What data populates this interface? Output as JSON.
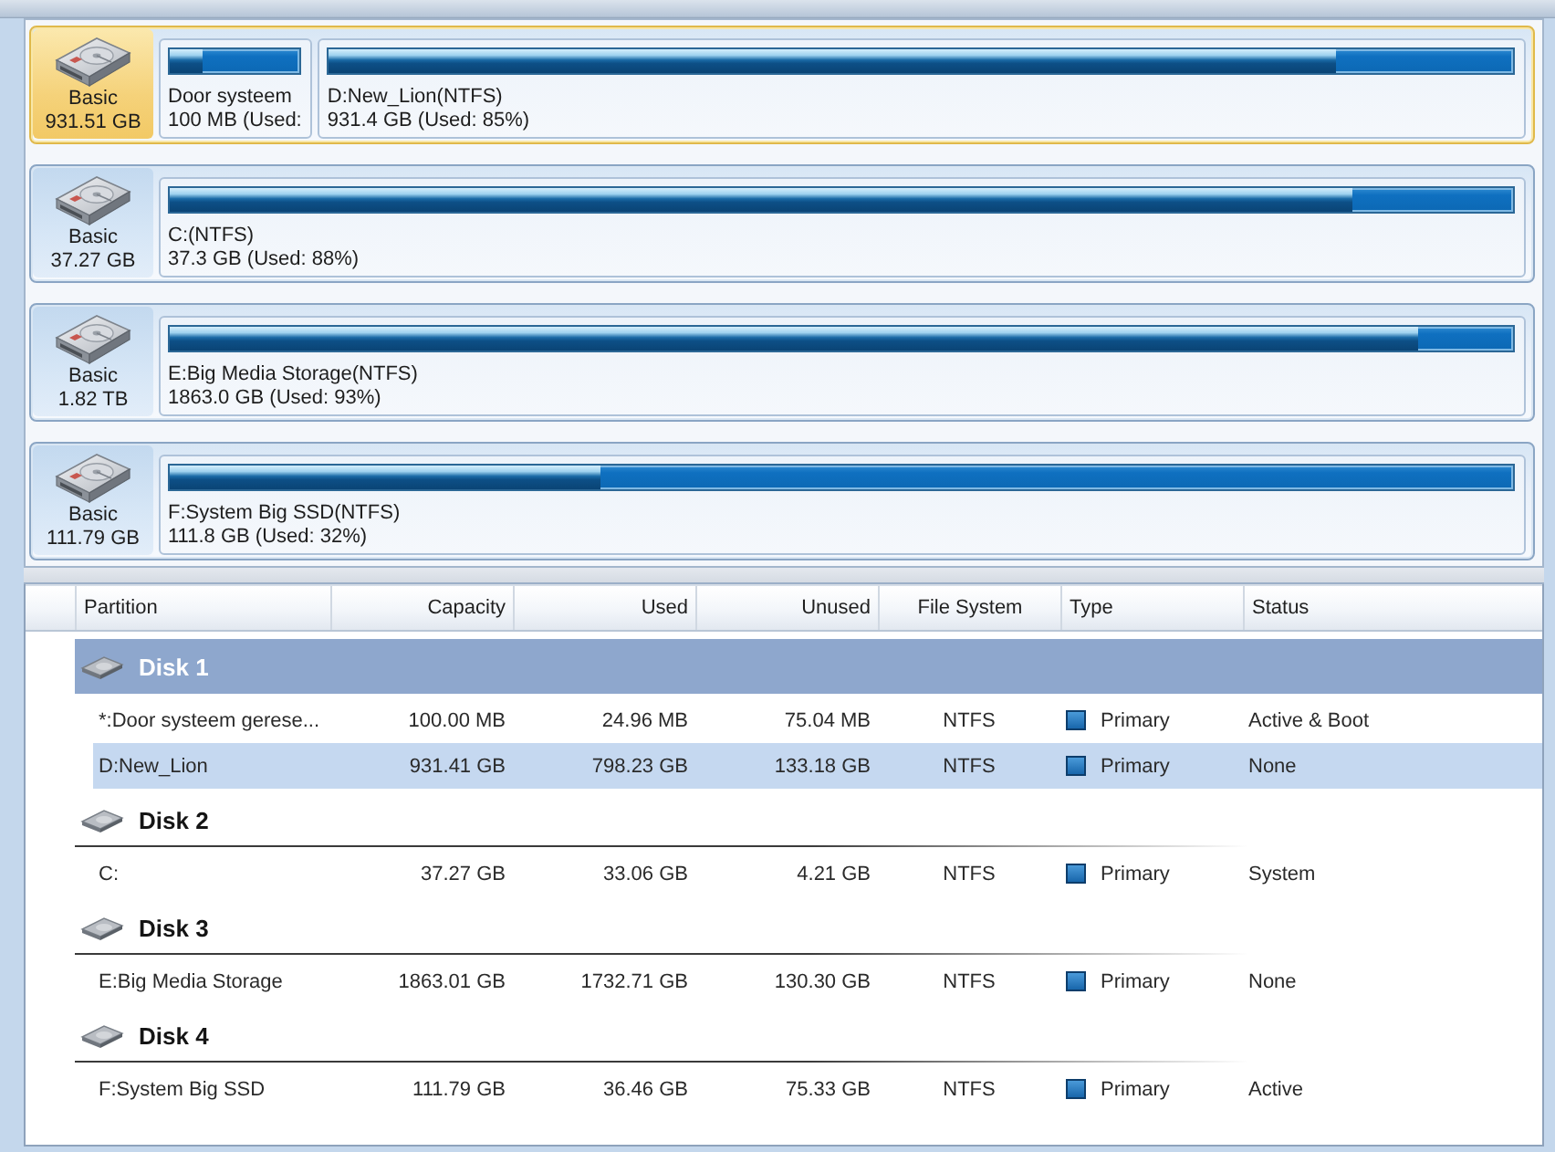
{
  "disk_map": [
    {
      "selected": true,
      "type": "Basic",
      "size": "931.51 GB",
      "partitions": [
        {
          "label": "Door systeem",
          "detail": "100 MB (Used:",
          "level": 0.25
        },
        {
          "label": "D:New_Lion(NTFS)",
          "detail": "931.4 GB (Used: 85%)",
          "level": 0.85
        }
      ]
    },
    {
      "selected": false,
      "type": "Basic",
      "size": "37.27 GB",
      "partitions": [
        {
          "label": "C:(NTFS)",
          "detail": "37.3 GB (Used: 88%)",
          "level": 0.88
        }
      ]
    },
    {
      "selected": false,
      "type": "Basic",
      "size": "1.82 TB",
      "partitions": [
        {
          "label": "E:Big Media Storage(NTFS)",
          "detail": "1863.0 GB (Used: 93%)",
          "level": 0.93
        }
      ]
    },
    {
      "selected": false,
      "type": "Basic",
      "size": "111.79 GB",
      "partitions": [
        {
          "label": "F:System Big SSD(NTFS)",
          "detail": "111.8 GB (Used: 32%)",
          "level": 0.32
        }
      ]
    }
  ],
  "table": {
    "columns": [
      "Partition",
      "Capacity",
      "Used",
      "Unused",
      "File System",
      "Type",
      "Status"
    ],
    "disks": [
      {
        "name": "Disk 1",
        "selected": true,
        "partitions": [
          {
            "partition": "*:Door systeem gerese...",
            "capacity": "100.00 MB",
            "used": "24.96 MB",
            "unused": "75.04 MB",
            "file_system": "NTFS",
            "type": "Primary",
            "status": "Active & Boot",
            "highlighted": false
          },
          {
            "partition": "D:New_Lion",
            "capacity": "931.41 GB",
            "used": "798.23 GB",
            "unused": "133.18 GB",
            "file_system": "NTFS",
            "type": "Primary",
            "status": "None",
            "highlighted": true
          }
        ]
      },
      {
        "name": "Disk 2",
        "selected": false,
        "partitions": [
          {
            "partition": "C:",
            "capacity": "37.27 GB",
            "used": "33.06 GB",
            "unused": "4.21 GB",
            "file_system": "NTFS",
            "type": "Primary",
            "status": "System",
            "highlighted": false
          }
        ]
      },
      {
        "name": "Disk 3",
        "selected": false,
        "partitions": [
          {
            "partition": "E:Big Media Storage",
            "capacity": "1863.01 GB",
            "used": "1732.71 GB",
            "unused": "130.30 GB",
            "file_system": "NTFS",
            "type": "Primary",
            "status": "None",
            "highlighted": false
          }
        ]
      },
      {
        "name": "Disk 4",
        "selected": false,
        "partitions": [
          {
            "partition": "F:System Big SSD",
            "capacity": "111.79 GB",
            "used": "36.46 GB",
            "unused": "75.33 GB",
            "file_system": "NTFS",
            "type": "Primary",
            "status": "Active",
            "highlighted": false
          }
        ]
      }
    ]
  }
}
